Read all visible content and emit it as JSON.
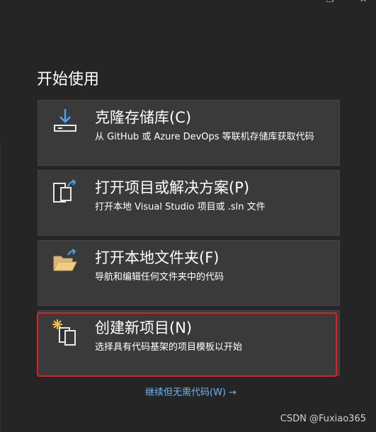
{
  "section_title": "开始使用",
  "cards": [
    {
      "title": "克隆存储库(C)",
      "desc": "从 GitHub 或 Azure DevOps 等联机存储库获取代码",
      "icon": "clone-download-icon"
    },
    {
      "title": "打开项目或解决方案(P)",
      "desc": "打开本地 Visual Studio 项目或 .sln 文件",
      "icon": "open-project-icon"
    },
    {
      "title": "打开本地文件夹(F)",
      "desc": "导航和编辑任何文件夹中的代码",
      "icon": "open-folder-icon"
    },
    {
      "title": "创建新项目(N)",
      "desc": "选择具有代码基架的项目模板以开始",
      "icon": "new-project-icon"
    }
  ],
  "continue_link": "继续但无需代码(W) →",
  "watermark": "CSDN @Fuxiao365",
  "colors": {
    "background": "#252526",
    "card": "#3a3a3a",
    "highlight": "#e02020",
    "link": "#6cb6f5"
  }
}
